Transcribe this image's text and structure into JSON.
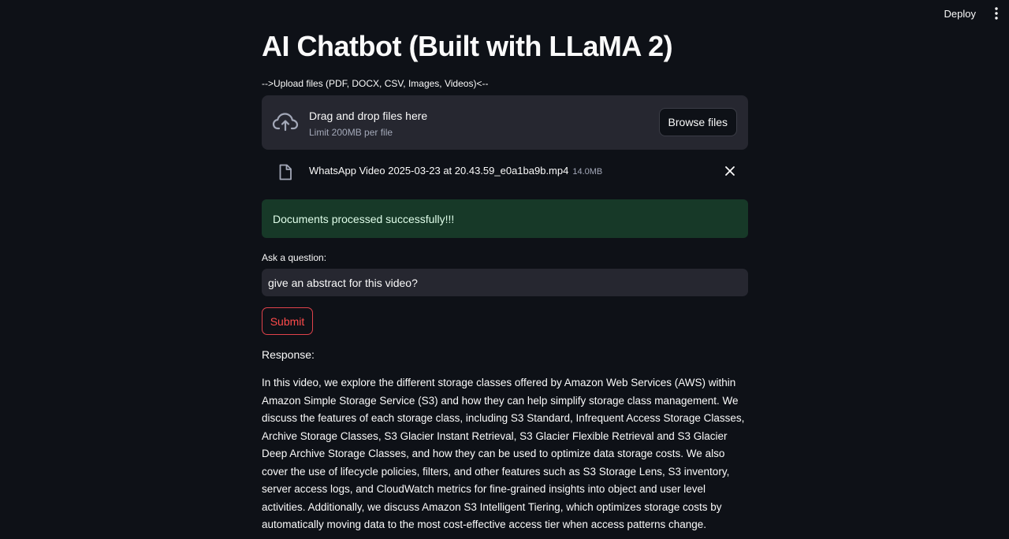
{
  "header": {
    "deploy_label": "Deploy",
    "menu_icon": "kebab-menu-icon"
  },
  "title": "AI Chatbot (Built with LLaMA 2)",
  "uploader": {
    "label": "-->Upload files (PDF, DOCX, CSV, Images, Videos)<--",
    "drop_text": "Drag and drop files here",
    "limit_text": "Limit 200MB per file",
    "browse_label": "Browse files",
    "icon": "cloud-upload-icon"
  },
  "uploaded_file": {
    "name": "WhatsApp Video 2025-03-23 at 20.43.59_e0a1ba9b.mp4",
    "size": "14.0MB",
    "icon": "file-icon",
    "remove_icon": "close-icon"
  },
  "status": {
    "message": "Documents processed successfully!!!",
    "color": "#173928"
  },
  "question": {
    "label": "Ask a question:",
    "value": "give an abstract for this video?"
  },
  "submit_label": "Submit",
  "response": {
    "label": "Response:",
    "text": "In this video, we explore the different storage classes offered by Amazon Web Services (AWS) within Amazon Simple Storage Service (S3) and how they can help simplify storage class management. We discuss the features of each storage class, including S3 Standard, Infrequent Access Storage Classes, Archive Storage Classes, S3 Glacier Instant Retrieval, S3 Glacier Flexible Retrieval and S3 Glacier Deep Archive Storage Classes, and how they can be used to optimize data storage costs. We also cover the use of lifecycle policies, filters, and other features such as S3 Storage Lens, S3 inventory, server access logs, and CloudWatch metrics for fine-grained insights into object and user level activities. Additionally, we discuss Amazon S3 Intelligent Tiering, which optimizes storage costs by automatically moving data to the most cost-effective access tier when access patterns change."
  },
  "colors": {
    "background": "#0e1117",
    "surface": "#262730",
    "accent": "#ff4b4b",
    "success_text": "#dffde9"
  }
}
